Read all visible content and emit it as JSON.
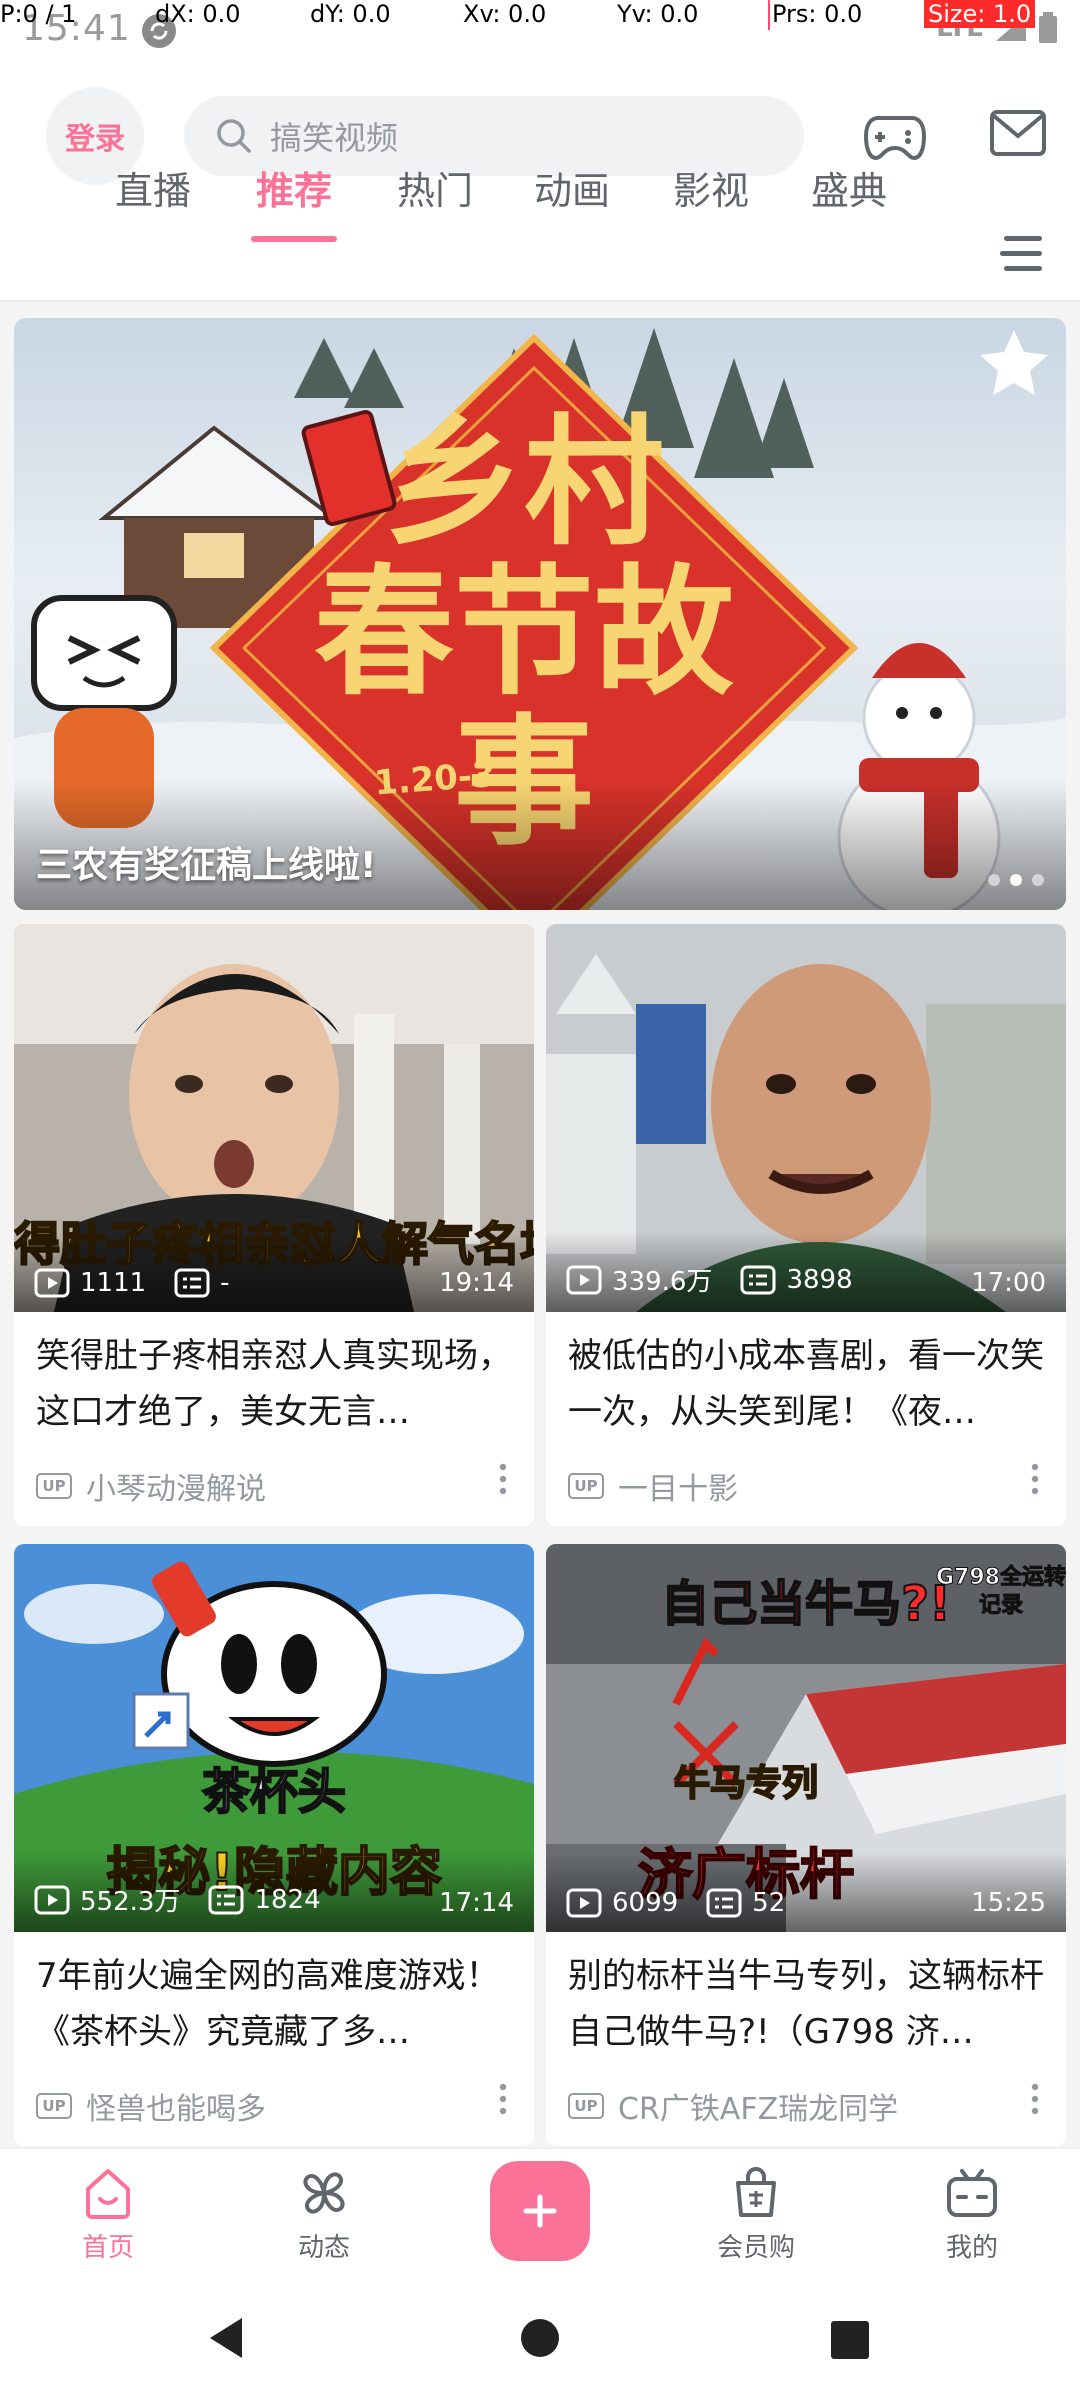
{
  "debug": {
    "pointer": "P:0 / 1",
    "dx": "dX: 0.0",
    "dy": "dY: 0.0",
    "xv": "Xv: 0.0",
    "yv": "Yv: 0.0",
    "prs": "Prs: 0.0",
    "size": "Size: 1.0"
  },
  "status_bar": {
    "time": "15:41",
    "network": "LTE"
  },
  "header": {
    "login_label": "登录",
    "search_placeholder": "搞笑视频"
  },
  "tabs": [
    {
      "label": "直播",
      "active": false
    },
    {
      "label": "推荐",
      "active": true
    },
    {
      "label": "热门",
      "active": false
    },
    {
      "label": "动画",
      "active": false
    },
    {
      "label": "影视",
      "active": false
    },
    {
      "label": "盛典",
      "active": false
    }
  ],
  "banner": {
    "title_line1": "乡村",
    "title_line2": "春节故事",
    "date": "1.20-3.2",
    "caption": "三农有奖征稿上线啦!",
    "dots": 3,
    "active_dot": 2
  },
  "cards": [
    {
      "thumb_caption": "得肚子疼相亲怼人解气名场",
      "plays": "1111",
      "danmaku": "-",
      "duration": "19:14",
      "title": "笑得肚子疼相亲怼人真实现场，这口才绝了，美女无言…",
      "up_name": "小琴动漫解说"
    },
    {
      "thumb_caption": "",
      "plays": "339.6万",
      "danmaku": "3898",
      "duration": "17:00",
      "title": "被低估的小成本喜剧，看一次笑一次，从头笑到尾！《夜…",
      "up_name": "一目十影"
    },
    {
      "thumb_caption": "揭秘!隐藏内容",
      "thumb_title": "茶杯头",
      "plays": "552.3万",
      "danmaku": "1824",
      "duration": "17:14",
      "title": "7年前火遍全网的高难度游戏！《茶杯头》究竟藏了多…",
      "up_name": "怪兽也能喝多"
    },
    {
      "thumb_caption": "济广标杆",
      "thumb_top": "自己当牛马?!",
      "thumb_mid": "牛马专列",
      "thumb_corner": "G798全运转记录",
      "plays": "6099",
      "danmaku": "52",
      "duration": "15:25",
      "title": "别的标杆当牛马专列，这辆标杆自己做牛马?!（G798 济…",
      "up_name": "CR广铁AFZ瑞龙同学"
    }
  ],
  "bottom_nav": [
    {
      "label": "首页",
      "icon": "home-icon",
      "active": true
    },
    {
      "label": "动态",
      "icon": "pinwheel-icon",
      "active": false
    },
    {
      "label": "会员购",
      "icon": "shopping-bag-icon",
      "active": false
    },
    {
      "label": "我的",
      "icon": "tv-icon",
      "active": false
    }
  ],
  "colors": {
    "accent": "#fb7299",
    "text_primary": "#18191c",
    "text_secondary": "#9499a0",
    "background": "#f4f4f4"
  },
  "up_badge": "UP"
}
